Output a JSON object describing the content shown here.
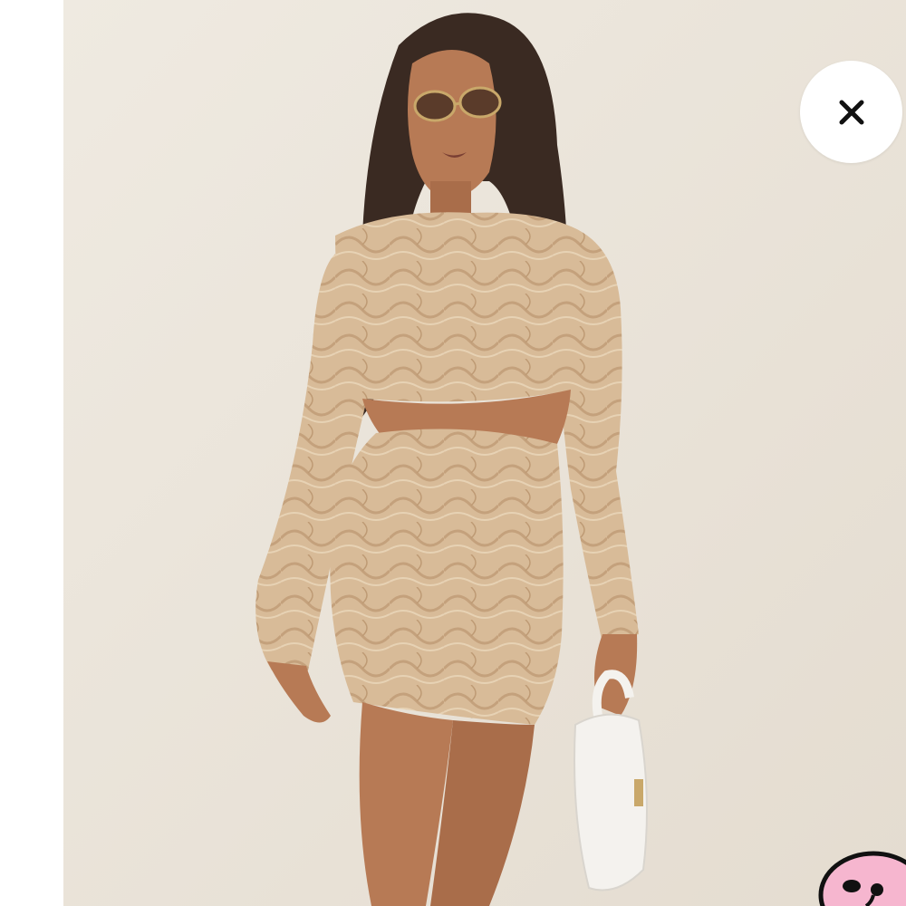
{
  "viewer": {
    "close_icon": "close-icon",
    "mascot_icon": "smiley-mascot-icon"
  },
  "photo": {
    "subject": "product-photo",
    "colors": {
      "wall": "#ECE6DC",
      "outfit": "#D8BB98",
      "outfit_shade": "#C4A17C",
      "skin": "#B77A55",
      "hair": "#3A2A22",
      "bag": "#F4F2EE"
    }
  },
  "mascot": {
    "colors": {
      "fill": "#F6B6CF",
      "outline": "#111111"
    }
  }
}
